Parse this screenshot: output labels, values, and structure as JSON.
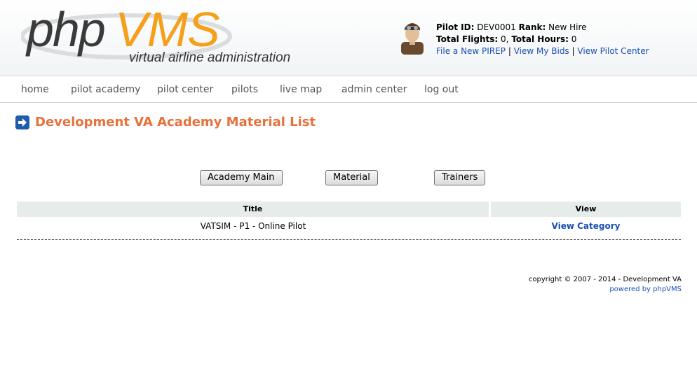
{
  "logo": {
    "php": "php",
    "vms": "VMS",
    "tagline": "virtual airline administration"
  },
  "pilot": {
    "id_label": "Pilot ID:",
    "id_value": "DEV0001",
    "rank_label": "Rank:",
    "rank_value": "New Hire",
    "flights_label": "Total Flights:",
    "flights_value": "0,",
    "hours_label": "Total Hours:",
    "hours_value": "0",
    "links": [
      "File a New PIREP",
      "View My Bids",
      "View Pilot Center"
    ],
    "separator": "|"
  },
  "nav": {
    "items": [
      "home",
      "pilot academy",
      "pilot center",
      "pilots",
      "live map",
      "admin center",
      "log out"
    ]
  },
  "page": {
    "title": "Development VA Academy Material List"
  },
  "buttons": {
    "academy_main": "Academy Main",
    "material": "Material",
    "trainers": "Trainers"
  },
  "table": {
    "headers": [
      "Title",
      "View"
    ],
    "rows": [
      {
        "title": "VATSIM - P1 - Online Pilot",
        "view": "View Category"
      }
    ]
  },
  "footer": {
    "copyright": "copyright © 2007 - 2014 - Development VA",
    "powered": "powered by phpVMS"
  },
  "colors": {
    "accent_orange": "#f6a01a",
    "title_orange": "#e8703a",
    "link_blue": "#1a4fb5",
    "table_header_bg": "#e6ecea"
  }
}
